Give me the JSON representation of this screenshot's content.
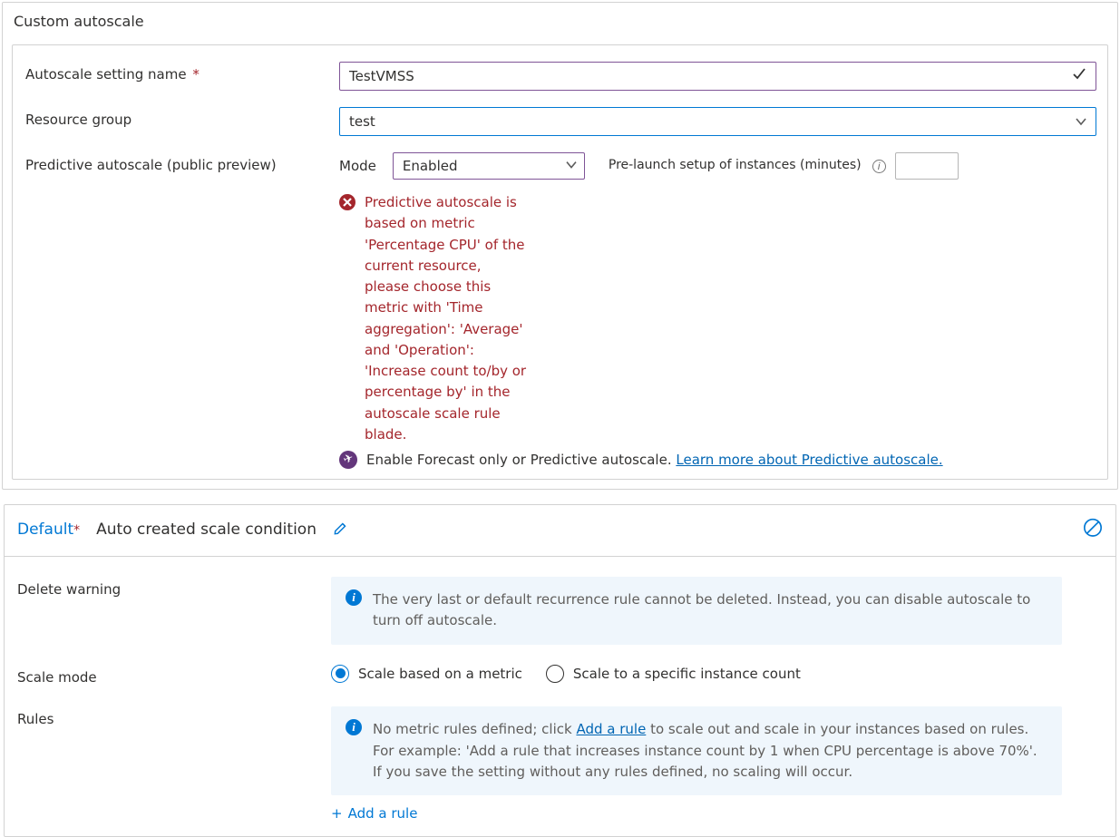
{
  "card": {
    "title": "Custom autoscale",
    "labels": {
      "autoscale_name": "Autoscale setting name",
      "resource_group": "Resource group",
      "predictive": "Predictive autoscale (public preview)",
      "mode": "Mode",
      "prelaunch": "Pre-launch setup of instances (minutes)"
    },
    "values": {
      "autoscale_name": "TestVMSS",
      "resource_group": "test",
      "mode": "Enabled",
      "prelaunch": ""
    },
    "error_text": "Predictive autoscale is based on metric 'Percentage CPU' of the current resource, please choose this metric with 'Time aggregation': 'Average' and 'Operation': 'Increase count to/by or percentage by' in the autoscale scale rule blade.",
    "forecast_text": "Enable Forecast only or Predictive autoscale. ",
    "forecast_link": "Learn more about Predictive autoscale."
  },
  "condition": {
    "default_label": "Default",
    "name": "Auto created scale condition",
    "labels": {
      "delete_warning": "Delete warning",
      "scale_mode": "Scale mode",
      "rules": "Rules"
    },
    "delete_warning_text": "The very last or default recurrence rule cannot be deleted. Instead, you can disable autoscale to turn off autoscale.",
    "scale_mode_options": {
      "metric": "Scale based on a metric",
      "count": "Scale to a specific instance count"
    },
    "rules_text_a": "No metric rules defined; click ",
    "rules_link": "Add a rule",
    "rules_text_b": " to scale out and scale in your instances based on rules. For example: 'Add a rule that increases instance count by 1 when CPU percentage is above 70%'. If you save the setting without any rules defined, no scaling will occur.",
    "add_rule": "Add a rule"
  }
}
